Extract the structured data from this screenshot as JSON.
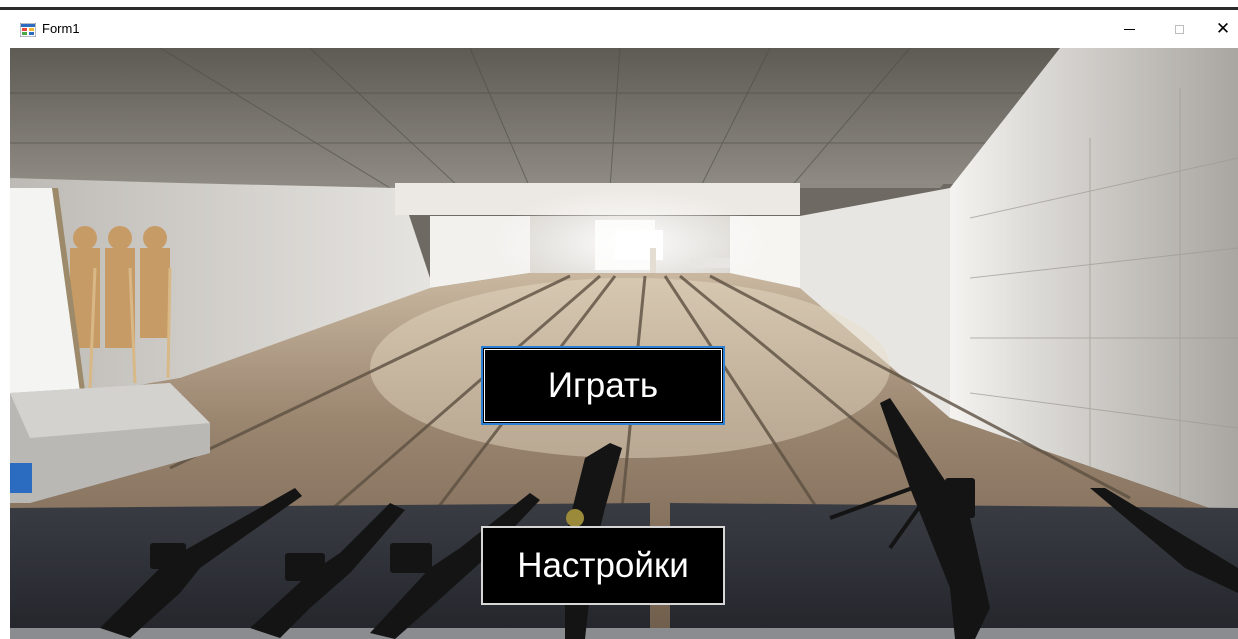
{
  "window": {
    "title": "Form1",
    "controls": {
      "minimize_icon": "minimize-icon",
      "maximize_icon": "maximize-icon",
      "close_glyph": "✕"
    }
  },
  "menu": {
    "play_label": "Играть",
    "settings_label": "Настройки"
  },
  "background": {
    "description_icon": "shooting-range-image"
  },
  "colors": {
    "button_bg": "#000000",
    "button_text": "#ffffff",
    "focus_border": "#2b7fd4"
  }
}
